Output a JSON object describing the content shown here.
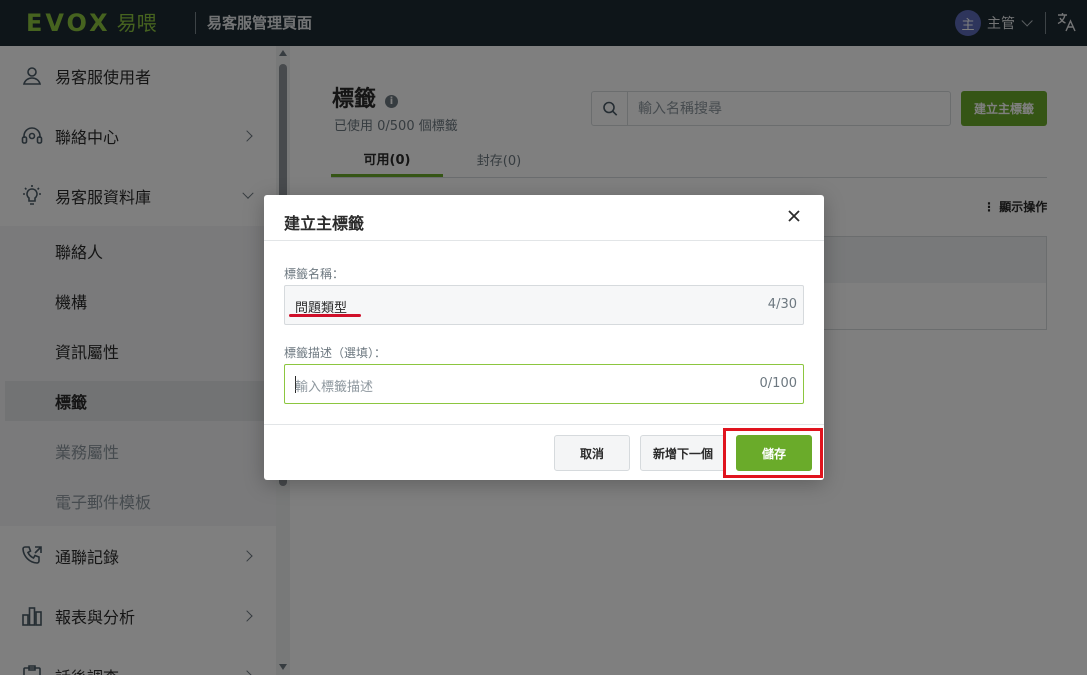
{
  "topbar": {
    "logo_brand": "EVOX",
    "logo_product": "易喂",
    "app_title": "易客服管理頁面",
    "user_avatar": "主",
    "user_name": "主管"
  },
  "sidebar": {
    "items": [
      {
        "label": "易客服使用者",
        "icon": "user-icon",
        "chevron": "none"
      },
      {
        "label": "聯絡中心",
        "icon": "headset-icon",
        "chevron": "right"
      },
      {
        "label": "易客服資料庫",
        "icon": "lightbulb-icon",
        "chevron": "down"
      },
      {
        "label": "通聯記錄",
        "icon": "phone-icon",
        "chevron": "right"
      },
      {
        "label": "報表與分析",
        "icon": "bar-chart-icon",
        "chevron": "right"
      },
      {
        "label": "話後調查",
        "icon": "survey-icon",
        "chevron": "right"
      }
    ],
    "sub_items": [
      {
        "label": "聯絡人",
        "state": "normal"
      },
      {
        "label": "機構",
        "state": "normal"
      },
      {
        "label": "資訊屬性",
        "state": "normal"
      },
      {
        "label": "標籤",
        "state": "active"
      },
      {
        "label": "業務屬性",
        "state": "muted"
      },
      {
        "label": "電子郵件模板",
        "state": "muted"
      }
    ]
  },
  "main": {
    "title": "標籤",
    "subtitle": "已使用 0/500 個標籤",
    "search_placeholder": "輸入名稱搜尋",
    "create_button": "建立主標籤",
    "tabs": [
      {
        "label": "可用(0)",
        "active": true
      },
      {
        "label": "封存(0)",
        "active": false
      }
    ],
    "more_actions": "顯示操作"
  },
  "modal": {
    "title": "建立主標籤",
    "name_label": "標籤名稱：",
    "name_value": "問題類型",
    "name_count": "4/30",
    "desc_label": "標籤描述（選填）：",
    "desc_placeholder": "輸入標籤描述",
    "desc_count": "0/100",
    "cancel_button": "取消",
    "next_button": "新增下一個",
    "save_button": "儲存"
  },
  "colors": {
    "brand_green": "#8cc63f",
    "button_green": "#6aab2a",
    "topbar_bg": "#1d2a33",
    "highlight_red": "#e0141e"
  }
}
